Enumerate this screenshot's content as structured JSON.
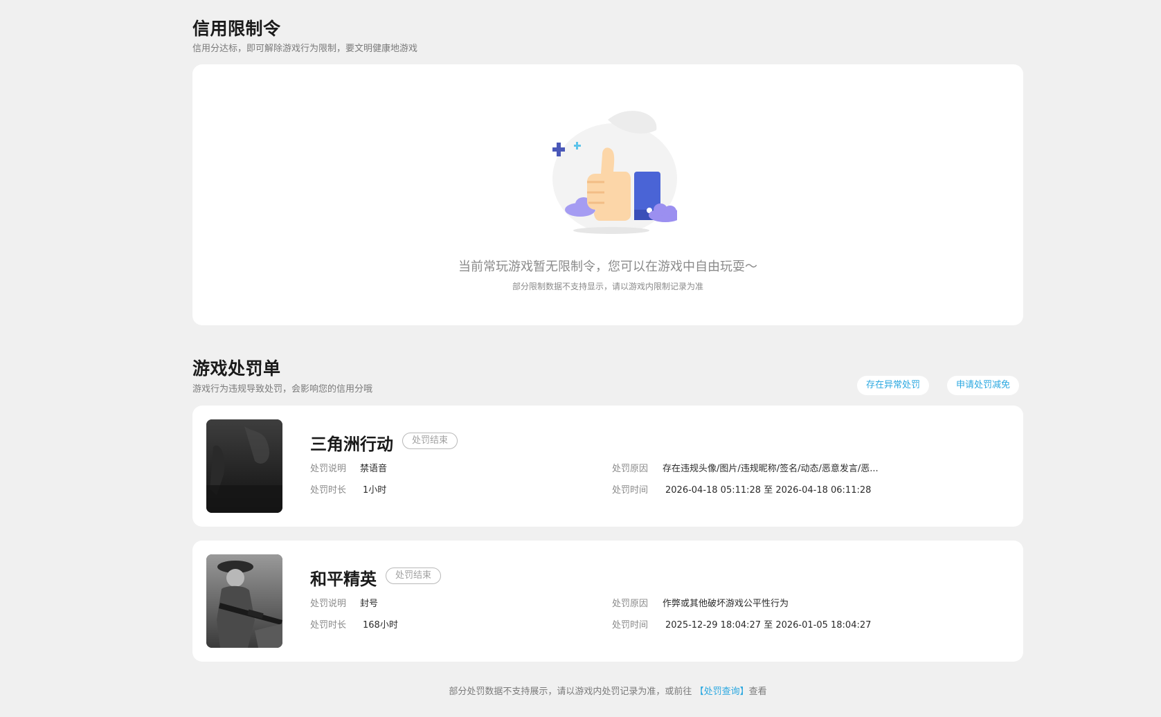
{
  "credit_section": {
    "title": "信用限制令",
    "subtitle": "信用分达标，即可解除游戏行为限制，要文明健康地游戏",
    "empty_main": "当前常玩游戏暂无限制令，您可以在游戏中自由玩耍～",
    "empty_note": "部分限制数据不支持显示，请以游戏内限制记录为准"
  },
  "punish_section": {
    "title": "游戏处罚单",
    "subtitle": "游戏行为违规导致处罚，会影响您的信用分哦",
    "abnormal_button": "存在异常处罚",
    "reduce_button": "申请处罚减免"
  },
  "records": [
    {
      "game": "三角洲行动",
      "status": "处罚结束",
      "desc_label": "处罚说明",
      "desc": "禁语音",
      "duration_label": "处罚时长",
      "duration": "1小时",
      "reason_label": "处罚原因",
      "reason": "存在违规头像/图片/违规昵称/签名/动态/恶意发言/恶...",
      "time_label": "处罚时间",
      "time": "2026-04-18 05:11:28 至 2026-04-18 06:11:28"
    },
    {
      "game": "和平精英",
      "status": "处罚结束",
      "desc_label": "处罚说明",
      "desc": "封号",
      "duration_label": "处罚时长",
      "duration": "168小时",
      "reason_label": "处罚原因",
      "reason": "作弊或其他破坏游戏公平性行为",
      "time_label": "处罚时间",
      "time": "2025-12-29 18:04:27 至 2026-01-05 18:04:27"
    }
  ],
  "footer": {
    "prefix": "部分处罚数据不支持展示，请以游戏内处罚记录为准，或前往",
    "link": "【处罚查询】",
    "suffix": "查看"
  },
  "colors": {
    "accent": "#2ba8e0",
    "background": "#f0f0f0",
    "card": "#ffffff"
  }
}
